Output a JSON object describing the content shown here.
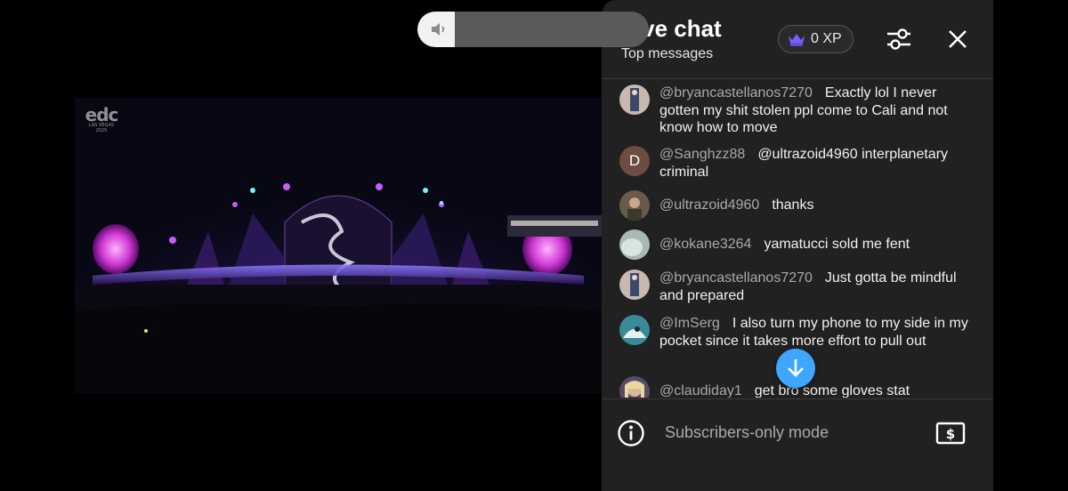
{
  "volume": {
    "level": 0.16,
    "icon": "speaker-icon"
  },
  "video": {
    "logo_text": "edc",
    "logo_subtext": "LAS VEGAS 2025"
  },
  "chat": {
    "title": "Live chat",
    "subtitle": "Top messages",
    "xp_label": "0 XP",
    "messages": [
      {
        "author": "@bryancastellanos7270",
        "text": "Exactly lol I never gotten my shit stolen ppl come to Cali and not know how to move",
        "avatar": "photo"
      },
      {
        "author": "@Sanghzz88",
        "text": "@ultrazoid4960 interplanetary criminal",
        "avatar": "D"
      },
      {
        "author": "@ultrazoid4960",
        "text": "thanks",
        "avatar": "photo"
      },
      {
        "author": "@kokane3264",
        "text": "yamatucci sold me fent",
        "avatar": "photo"
      },
      {
        "author": "@bryancastellanos7270",
        "text": "Just gotta be mindful and prepared",
        "avatar": "photo"
      },
      {
        "author": "@ImSerg",
        "text": "I also turn my phone to my side in my pocket since it takes more effort to pull out",
        "avatar": "photo"
      },
      {
        "author": "@claudiday1",
        "text": "get bro some gloves stat",
        "avatar": "photo"
      }
    ],
    "footer_label": "Subscribers-only mode"
  },
  "colors": {
    "panel_bg": "#212121",
    "accent_blue": "#3ea6ff",
    "crown_purple": "#7b5cff",
    "author_grey": "#a8a8a8"
  }
}
